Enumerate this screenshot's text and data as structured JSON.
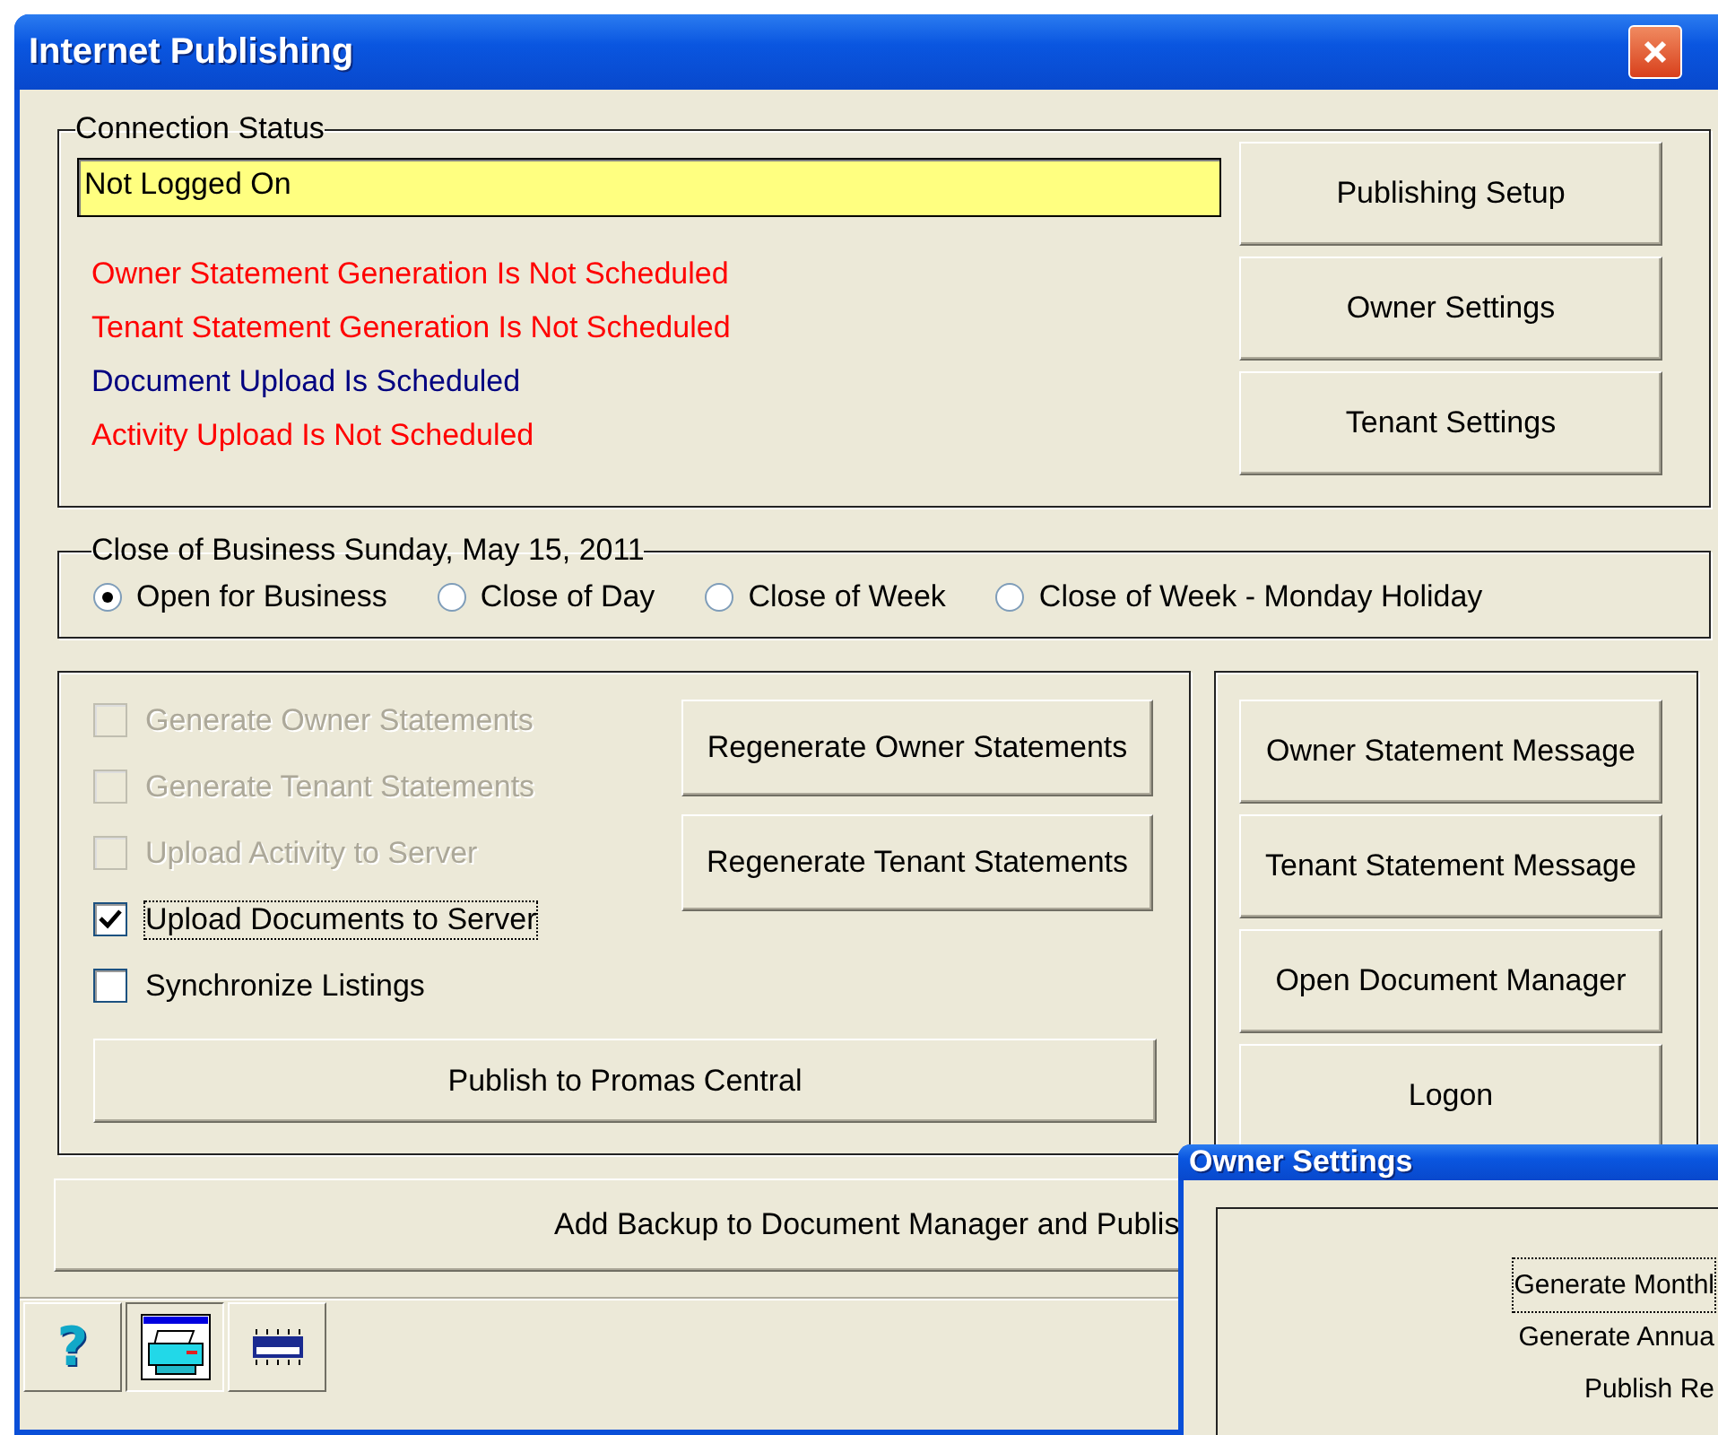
{
  "window": {
    "title": "Internet Publishing"
  },
  "connection_status": {
    "label": "Connection Status",
    "value": "Not Logged On",
    "messages": [
      {
        "text": "Owner Statement Generation Is Not Scheduled",
        "color": "#ff0000"
      },
      {
        "text": "Tenant Statement Generation Is Not Scheduled",
        "color": "#ff0000"
      },
      {
        "text": "Document Upload Is Scheduled",
        "color": "#000080"
      },
      {
        "text": "Activity Upload Is Not Scheduled",
        "color": "#ff0000"
      }
    ],
    "buttons": [
      "Publishing Setup",
      "Owner Settings",
      "Tenant Settings"
    ]
  },
  "close_of_business": {
    "label": "Close of Business Sunday, May 15, 2011",
    "options": [
      {
        "label": "Open for Business",
        "selected": true
      },
      {
        "label": "Close of Day",
        "selected": false
      },
      {
        "label": "Close of Week",
        "selected": false
      },
      {
        "label": "Close of Week - Monday Holiday",
        "selected": false
      }
    ]
  },
  "tasks": {
    "checkboxes": [
      {
        "label": "Generate Owner Statements",
        "checked": false,
        "disabled": true,
        "focused": false
      },
      {
        "label": "Generate Tenant Statements",
        "checked": false,
        "disabled": true,
        "focused": false
      },
      {
        "label": "Upload Activity to Server",
        "checked": false,
        "disabled": true,
        "focused": false
      },
      {
        "label": "Upload Documents to Server",
        "checked": true,
        "disabled": false,
        "focused": true
      },
      {
        "label": "Synchronize Listings",
        "checked": false,
        "disabled": false,
        "focused": false
      }
    ],
    "regenerate_buttons": [
      "Regenerate Owner Statements",
      "Regenerate Tenant Statements"
    ],
    "publish_button": "Publish to Promas Central"
  },
  "message_buttons": [
    "Owner Statement Message",
    "Tenant Statement Message",
    "Open Document Manager",
    "Logon"
  ],
  "backup_button": "Add Backup to Document Manager and Publis",
  "toolbar": [
    {
      "kind": "help",
      "glyph": "?",
      "selected": false
    },
    {
      "kind": "printer",
      "selected": true
    },
    {
      "kind": "chip",
      "selected": false
    }
  ],
  "owner_settings": {
    "title": "Owner Settings",
    "items": [
      {
        "label": "Generate Monthl",
        "focused": true
      },
      {
        "label": "Generate Annua",
        "focused": false
      },
      {
        "label": "Publish Re",
        "focused": false
      }
    ]
  }
}
